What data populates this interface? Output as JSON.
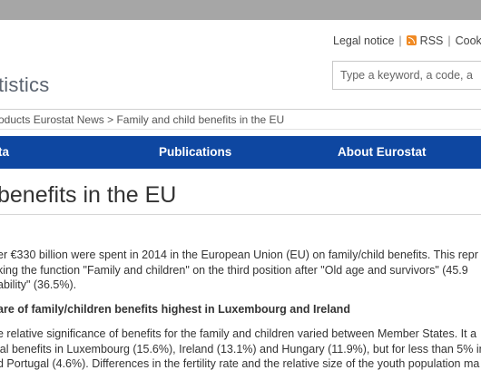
{
  "header": {
    "links": [
      "Legal notice",
      "RSS",
      "Cookie"
    ],
    "site_name": "tistics",
    "search_placeholder": "Type a keyword, a code, a"
  },
  "breadcrumb": {
    "items": [
      "oducts",
      "Eurostat News",
      "Family and child benefits in the EU"
    ],
    "separator": ">"
  },
  "nav": {
    "items": [
      "ta",
      "Publications",
      "About Eurostat"
    ]
  },
  "article": {
    "title": "benefits in the EU",
    "paragraph1": [
      "er €330 billion were spent in 2014 in the European Union (EU) on family/child benefits. This repr",
      "king the function \"Family and children\" on the third position after \"Old age and survivors\" (45.9",
      "ability\" (36.5%)."
    ],
    "subheading": "are of family/children benefits highest in Luxembourg and Ireland",
    "paragraph2": [
      "e relative significance of benefits for the family and children varied between Member States. It a",
      "ial benefits in Luxembourg (15.6%), Ireland (13.1%) and Hungary (11.9%), but for less than 5% in",
      "d Portugal (4.6%). Differences in the fertility rate and the relative size of the youth population ma"
    ]
  },
  "colors": {
    "nav_background": "#0e47a1",
    "top_strip": "#a6a6a6",
    "rss": "#f08a24"
  }
}
